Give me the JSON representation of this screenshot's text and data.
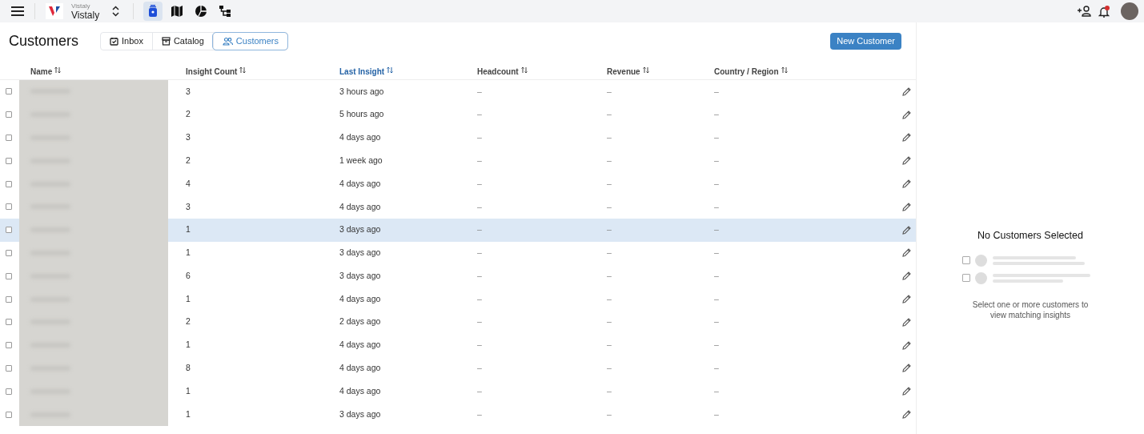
{
  "top_bar": {
    "workspace_label": "Vistaly",
    "workspace_name": "Vistaly",
    "nav_icons": [
      {
        "kind": "insight",
        "selected": true
      },
      {
        "kind": "map",
        "selected": false
      },
      {
        "kind": "chart",
        "selected": false
      },
      {
        "kind": "tree",
        "selected": false
      }
    ],
    "notification_dot": true
  },
  "page": {
    "title": "Customers",
    "tabs": [
      {
        "kind": "inbox",
        "label": "Inbox",
        "selected": false
      },
      {
        "kind": "catalog",
        "label": "Catalog",
        "selected": false
      },
      {
        "kind": "customers",
        "label": "Customers",
        "selected": true
      }
    ],
    "new_button": "New Customer"
  },
  "table": {
    "columns": [
      {
        "label": "Name",
        "sorted": false
      },
      {
        "label": "Insight Count",
        "sorted": false
      },
      {
        "label": "Last Insight",
        "sorted": true
      },
      {
        "label": "Headcount",
        "sorted": false
      },
      {
        "label": "Revenue",
        "sorted": false
      },
      {
        "label": "Country / Region",
        "sorted": false
      }
    ],
    "rows": [
      {
        "checked": false,
        "hovered": false,
        "insight_count": "3",
        "last_insight": "3 hours ago",
        "headcount": "–",
        "revenue": "–",
        "country": "–"
      },
      {
        "checked": false,
        "hovered": false,
        "insight_count": "2",
        "last_insight": "5 hours ago",
        "headcount": "–",
        "revenue": "–",
        "country": "–"
      },
      {
        "checked": false,
        "hovered": false,
        "insight_count": "3",
        "last_insight": "4 days ago",
        "headcount": "–",
        "revenue": "–",
        "country": "–"
      },
      {
        "checked": false,
        "hovered": false,
        "insight_count": "2",
        "last_insight": "1 week ago",
        "headcount": "–",
        "revenue": "–",
        "country": "–"
      },
      {
        "checked": false,
        "hovered": false,
        "insight_count": "4",
        "last_insight": "4 days ago",
        "headcount": "–",
        "revenue": "–",
        "country": "–"
      },
      {
        "checked": false,
        "hovered": false,
        "insight_count": "3",
        "last_insight": "4 days ago",
        "headcount": "–",
        "revenue": "–",
        "country": "–"
      },
      {
        "checked": false,
        "hovered": true,
        "insight_count": "1",
        "last_insight": "3 days ago",
        "headcount": "–",
        "revenue": "–",
        "country": "–"
      },
      {
        "checked": false,
        "hovered": false,
        "insight_count": "1",
        "last_insight": "3 days ago",
        "headcount": "–",
        "revenue": "–",
        "country": "–"
      },
      {
        "checked": false,
        "hovered": false,
        "insight_count": "6",
        "last_insight": "3 days ago",
        "headcount": "–",
        "revenue": "–",
        "country": "–"
      },
      {
        "checked": false,
        "hovered": false,
        "insight_count": "1",
        "last_insight": "4 days ago",
        "headcount": "–",
        "revenue": "–",
        "country": "–"
      },
      {
        "checked": false,
        "hovered": false,
        "insight_count": "2",
        "last_insight": "2 days ago",
        "headcount": "–",
        "revenue": "–",
        "country": "–"
      },
      {
        "checked": false,
        "hovered": false,
        "insight_count": "1",
        "last_insight": "4 days ago",
        "headcount": "–",
        "revenue": "–",
        "country": "–"
      },
      {
        "checked": false,
        "hovered": false,
        "insight_count": "8",
        "last_insight": "4 days ago",
        "headcount": "–",
        "revenue": "–",
        "country": "–"
      },
      {
        "checked": false,
        "hovered": false,
        "insight_count": "1",
        "last_insight": "4 days ago",
        "headcount": "–",
        "revenue": "–",
        "country": "–"
      },
      {
        "checked": false,
        "hovered": false,
        "insight_count": "1",
        "last_insight": "3 days ago",
        "headcount": "–",
        "revenue": "–",
        "country": "–"
      }
    ]
  },
  "side_panel": {
    "title": "No Customers Selected",
    "message": "Select one or more customers to view matching insights"
  }
}
